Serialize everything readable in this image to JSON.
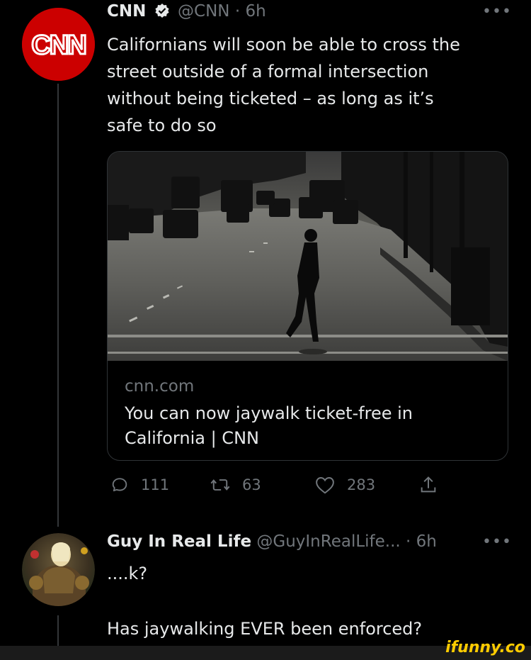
{
  "tweet1": {
    "author_name": "CNN",
    "verified": true,
    "handle": "@CNN",
    "separator": "·",
    "time": "6h",
    "avatar_text": "CNN",
    "text_lines": [
      "Californians will soon be able to cross the",
      "street outside of a formal intersection",
      "without being ticketed – as long as it’s",
      "safe to do so"
    ],
    "card": {
      "domain": "cnn.com",
      "title": "You can now jaywalk ticket-free in California | CNN"
    },
    "actions": {
      "replies": "111",
      "retweets": "63",
      "likes": "283"
    }
  },
  "tweet2": {
    "author_name": "Guy In Real Life",
    "handle": "@GuyInRealLife...",
    "separator": "·",
    "time": "6h",
    "text_lines": [
      "....k?",
      "",
      "Has jaywalking EVER been enforced?"
    ]
  },
  "watermark": "ifunny.co",
  "colors": {
    "background": "#000000",
    "text": "#e7e9ea",
    "muted": "#71767b",
    "cnn_red": "#cc0000",
    "watermark": "#ffcc00"
  }
}
